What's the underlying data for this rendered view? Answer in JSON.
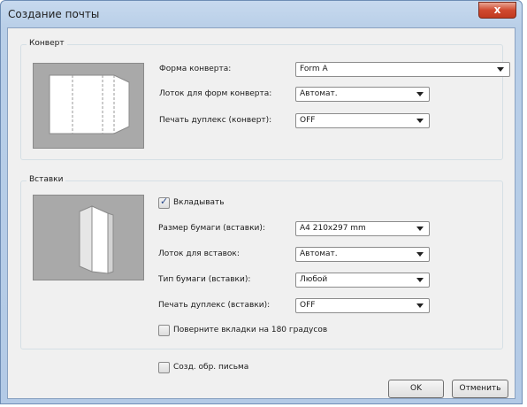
{
  "window": {
    "title": "Создание почты",
    "close_symbol": "x"
  },
  "envelope": {
    "group_label": "Конверт",
    "fields": [
      {
        "label": "Форма конверта:",
        "value": "Form A"
      },
      {
        "label": "Лоток для форм конверта:",
        "value": "Автомат."
      },
      {
        "label": "Печать дуплекс (конверт):",
        "value": "OFF"
      }
    ]
  },
  "inserts": {
    "group_label": "Вставки",
    "insert_checkbox": {
      "label": "Вкладывать",
      "checked": true
    },
    "fields": [
      {
        "label": "Размер бумаги (вставки):",
        "value": "A4 210x297 mm"
      },
      {
        "label": "Лоток для вставок:",
        "value": "Автомат."
      },
      {
        "label": "Тип бумаги (вставки):",
        "value": "Любой"
      },
      {
        "label": "Печать дуплекс (вставки):",
        "value": "OFF"
      }
    ],
    "rotate_checkbox": {
      "label": "Поверните вкладки на 180 градусов",
      "checked": false
    }
  },
  "template_checkbox": {
    "label": "Созд. обр. письма",
    "checked": false
  },
  "buttons": {
    "ok": "OK",
    "cancel": "Отменить"
  },
  "colors": {
    "title_bar": "#b9cfe8",
    "close_button": "#d0492f",
    "client_bg": "#f0f0f0",
    "preview_bg": "#a9a9a9"
  },
  "icons": {
    "close": "close-icon",
    "dropdown": "chevron-down-icon",
    "checkbox_mark": "checkmark-icon"
  }
}
